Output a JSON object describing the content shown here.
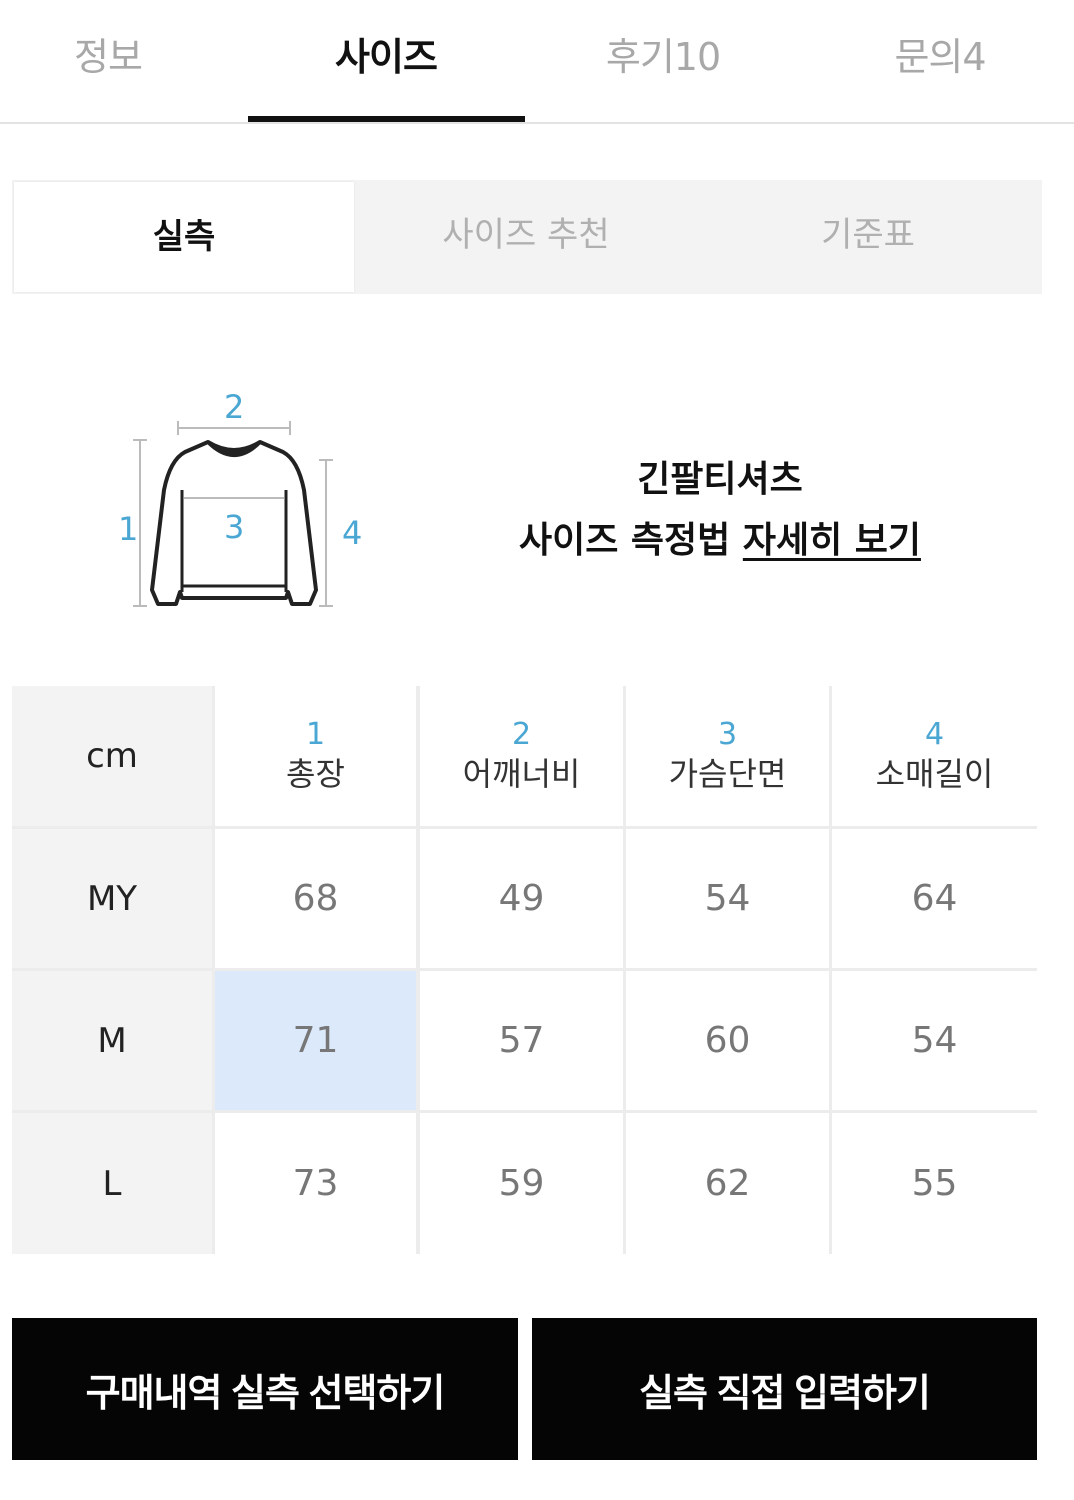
{
  "top_tabs": [
    {
      "label": "정보"
    },
    {
      "label": "사이즈"
    },
    {
      "label": "후기10"
    },
    {
      "label": "문의4"
    }
  ],
  "sub_tabs": [
    {
      "label": "실측"
    },
    {
      "label": "사이즈 추천"
    },
    {
      "label": "기준표"
    }
  ],
  "diagram": {
    "markers": [
      "1",
      "2",
      "3",
      "4"
    ],
    "marker_color": "#4aa6d2"
  },
  "info": {
    "title": "긴팔티셔츠",
    "line_prefix": "사이즈 측정법",
    "link_label": "자세히 보기"
  },
  "table": {
    "unit_label": "cm",
    "columns": [
      {
        "num": "1",
        "label": "총장"
      },
      {
        "num": "2",
        "label": "어깨너비"
      },
      {
        "num": "3",
        "label": "가슴단면"
      },
      {
        "num": "4",
        "label": "소매길이"
      }
    ],
    "rows": [
      {
        "size": "MY",
        "values": [
          "68",
          "49",
          "54",
          "64"
        ]
      },
      {
        "size": "M",
        "values": [
          "71",
          "57",
          "60",
          "54"
        ]
      },
      {
        "size": "L",
        "values": [
          "73",
          "59",
          "62",
          "55"
        ]
      }
    ],
    "highlight_color": "#dce9fb"
  },
  "buttons": {
    "purchase_history": "구매내역 실측 선택하기",
    "manual_input": "실측 직접 입력하기"
  }
}
